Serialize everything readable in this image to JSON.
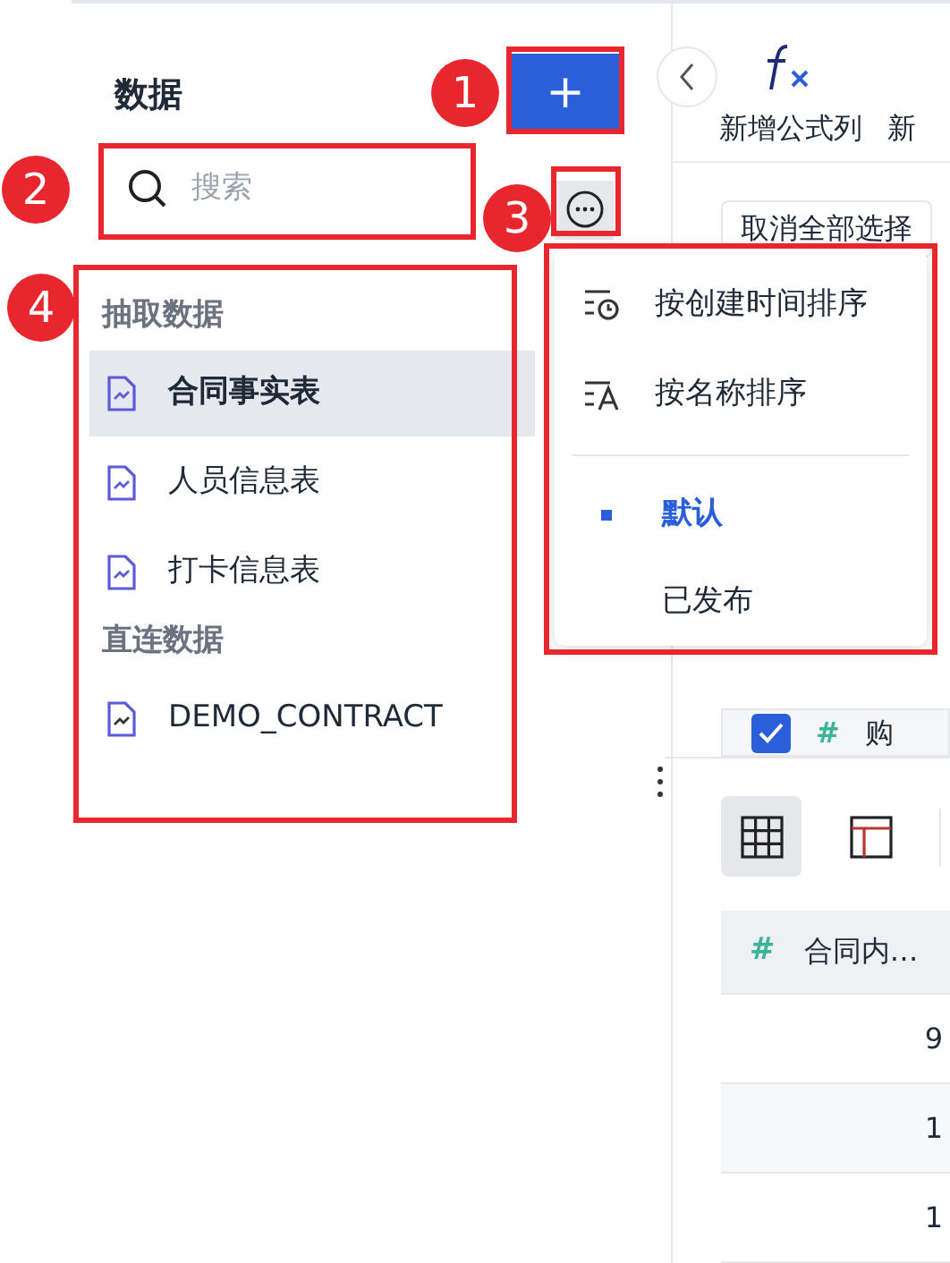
{
  "sidebar": {
    "title": "数据",
    "search": {
      "placeholder": "搜索"
    },
    "groups": [
      {
        "label": "抽取数据",
        "items": [
          {
            "label": "合同事实表",
            "selected": true
          },
          {
            "label": "人员信息表",
            "selected": false
          },
          {
            "label": "打卡信息表",
            "selected": false
          }
        ]
      },
      {
        "label": "直连数据",
        "items": [
          {
            "label": "DEMO_CONTRACT",
            "selected": false
          }
        ]
      }
    ]
  },
  "add_button": {
    "label": "+"
  },
  "sort_menu": {
    "sort_items": [
      {
        "label": "按创建时间排序"
      },
      {
        "label": "按名称排序"
      }
    ],
    "filters": [
      {
        "label": "默认",
        "selected": true
      },
      {
        "label": "已发布",
        "selected": false
      }
    ]
  },
  "toolbar": {
    "items": [
      {
        "label": "新增公式列"
      },
      {
        "label": "新"
      }
    ]
  },
  "deselect_button": {
    "label": "取消全部选择"
  },
  "field_row": {
    "checked": true,
    "symbol": "#",
    "label": "购"
  },
  "view_toggles": [
    {
      "selected": true
    },
    {
      "selected": false
    }
  ],
  "table": {
    "column": {
      "symbol": "#",
      "label": "合同内…"
    },
    "rows": [
      "9",
      "1",
      "1"
    ]
  },
  "annotations": [
    {
      "number": "1"
    },
    {
      "number": "2"
    },
    {
      "number": "3"
    },
    {
      "number": "4"
    }
  ]
}
